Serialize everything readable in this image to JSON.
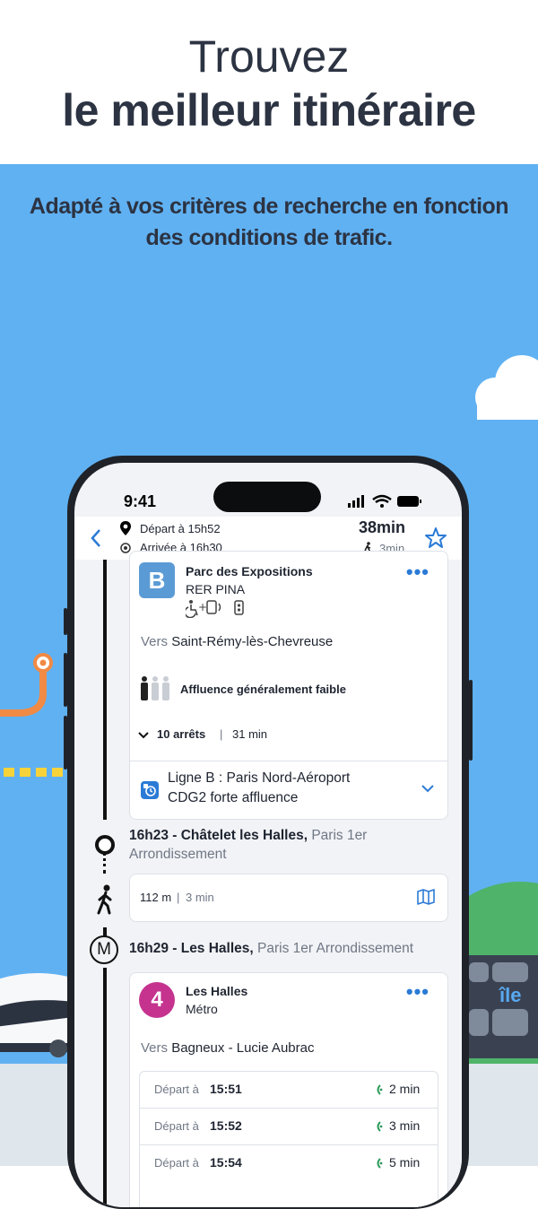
{
  "header": {
    "line1": "Trouvez",
    "line2": "le meilleur itinéraire"
  },
  "subtitle": {
    "line1": "Adapté à vos critères de recherche en fonction",
    "line2": "des conditions de trafic."
  },
  "phone": {
    "clock": "9:41",
    "trip": {
      "depart": "Départ à 15h52",
      "arrival": "Arrivée à 16h30",
      "duration": "38min",
      "walk": "3min"
    },
    "leg1": {
      "line_badge": "B",
      "badge_color": "#5b9bd5",
      "stop": "Parc des Expositions",
      "mission": "RER PINA",
      "direction_prefix": "Vers",
      "direction": "Saint-Rémy-lès-Chevreuse",
      "crowd": "Affluence généralement faible",
      "stops_count": "10 arrêts",
      "stops_time": "31 min",
      "alert_line1": "Ligne B : Paris Nord-Aéroport",
      "alert_line2": "CDG2 forte affluence"
    },
    "transfer": {
      "time_stop": "16h23 - Châtelet les Halles,",
      "area": " Paris 1er",
      "area2": "Arrondissement",
      "walk_distance": "112 m",
      "walk_time": "3 min"
    },
    "metro": {
      "time_stop": "16h29 - Les Halles,",
      "area": " Paris 1er Arrondissement",
      "marker": "M"
    },
    "leg2": {
      "line_badge": "4",
      "badge_color": "#c5338f",
      "stop": "Les Halles",
      "mode": "Métro",
      "direction_prefix": "Vers",
      "direction": "Bagneux - Lucie Aubrac",
      "departures": [
        {
          "label": "Départ à",
          "time": "15:51",
          "wait": "2 min"
        },
        {
          "label": "Départ à",
          "time": "15:52",
          "wait": "3 min"
        },
        {
          "label": "Départ à",
          "time": "15:54",
          "wait": "5 min"
        }
      ]
    }
  },
  "train_logo": "île",
  "colors": {
    "sky": "#60b1f2",
    "accent": "#2b7bd6",
    "live": "#2e9c5a"
  }
}
